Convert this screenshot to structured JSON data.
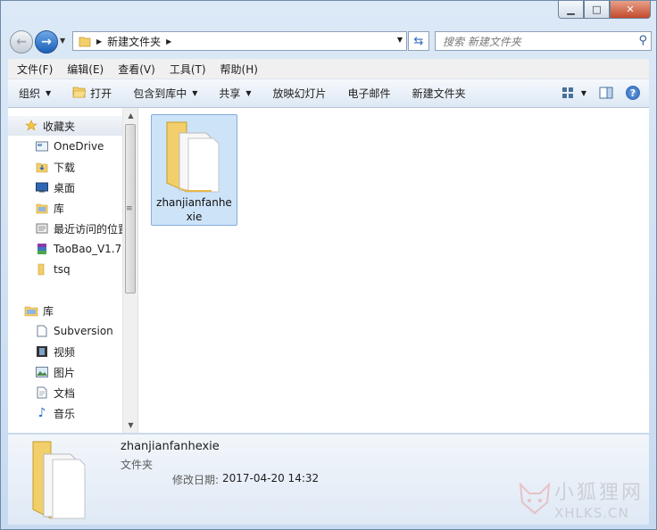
{
  "window": {
    "caption": {
      "minimize": "▁",
      "maximize": "□",
      "close": "✕"
    }
  },
  "address": {
    "folder": "新建文件夹",
    "search_placeholder": "搜索 新建文件夹"
  },
  "menu": [
    "文件(F)",
    "编辑(E)",
    "查看(V)",
    "工具(T)",
    "帮助(H)"
  ],
  "commands": {
    "organize": "组织",
    "open": "打开",
    "include": "包含到库中",
    "share": "共享",
    "slideshow": "放映幻灯片",
    "email": "电子邮件",
    "new_folder": "新建文件夹"
  },
  "nav": {
    "favorites": "收藏夹",
    "fav_items": [
      "OneDrive",
      "下载",
      "桌面",
      "库",
      "最近访问的位置",
      "TaoBao_V1.7",
      "tsq"
    ],
    "libraries": "库",
    "lib_items": [
      "Subversion",
      "视频",
      "图片",
      "文档",
      "音乐"
    ]
  },
  "content": {
    "item": "zhanjianfanhexie"
  },
  "details": {
    "name": "zhanjianfanhexie",
    "type": "文件夹",
    "date_label": "修改日期:",
    "date": "2017-04-20 14:32"
  },
  "watermark": {
    "cn": "小狐狸网",
    "en": "XHLKS.CN"
  },
  "colors": {
    "accent": "#1a5fb8",
    "selection": "#cde3f8",
    "folder": "#f2cf6a"
  }
}
